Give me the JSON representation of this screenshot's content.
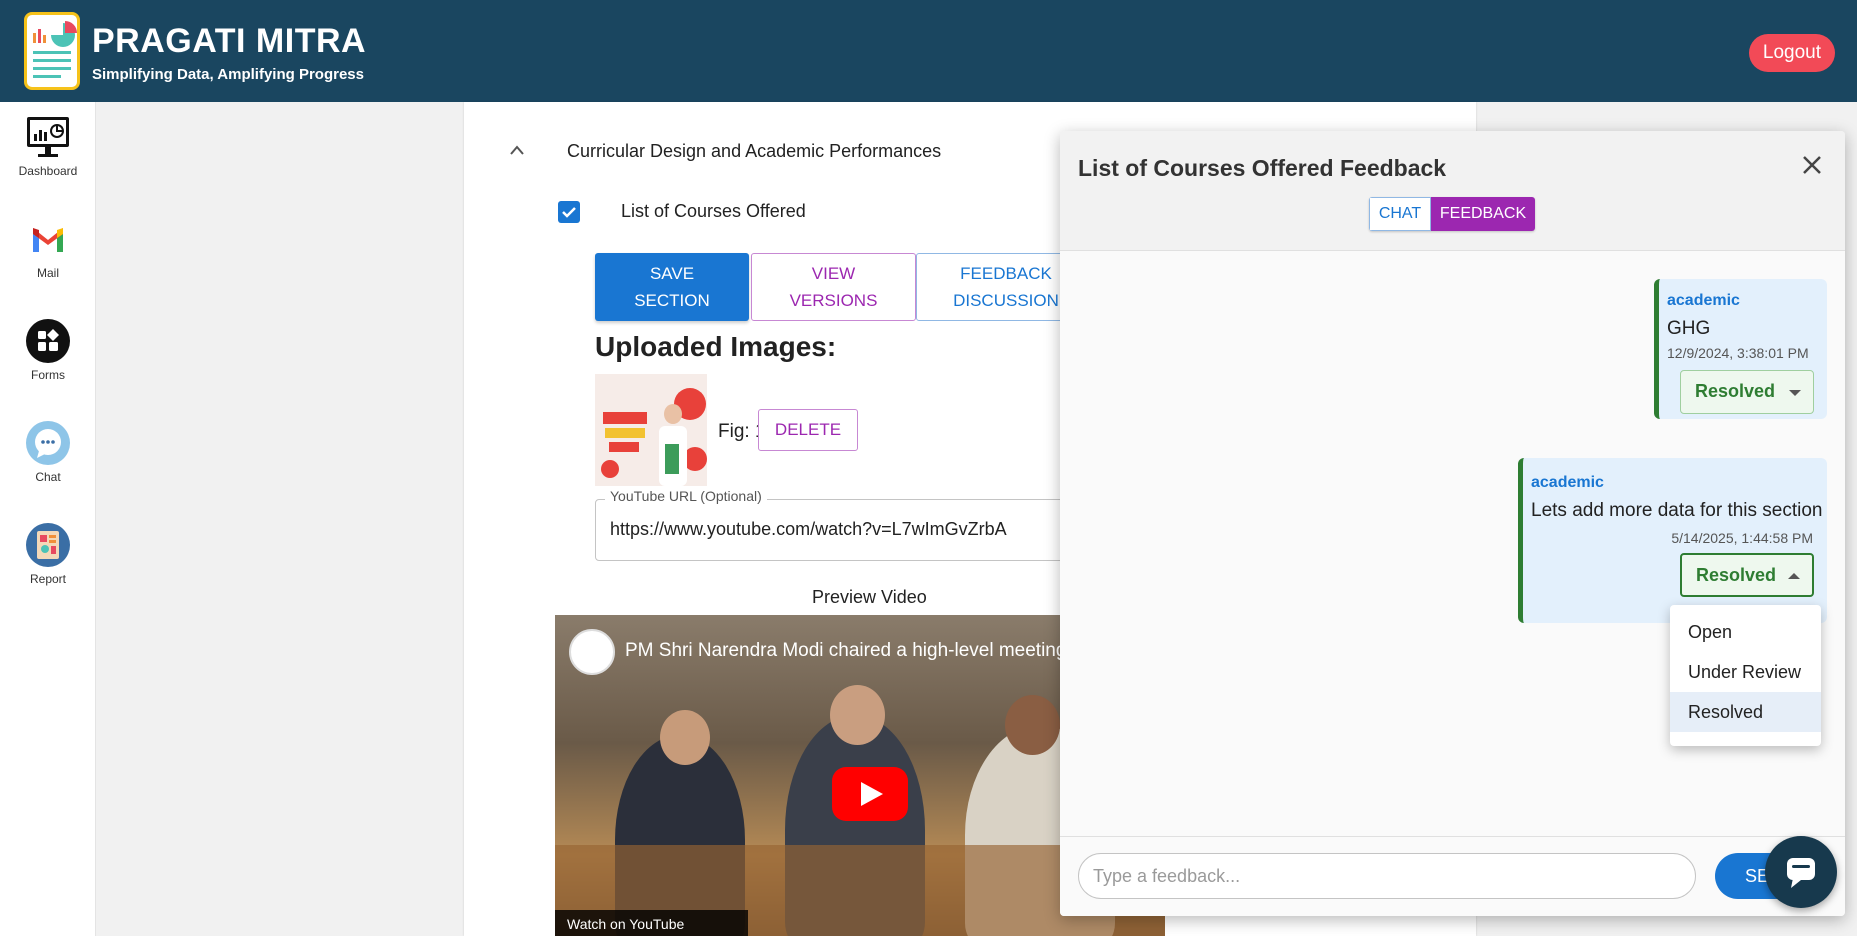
{
  "app": {
    "title": "PRAGATI MITRA",
    "subtitle": "Simplifying Data, Amplifying Progress",
    "logout_label": "Logout"
  },
  "sidebar": {
    "items": [
      {
        "label": "Dashboard",
        "icon": "monitor-chart-icon"
      },
      {
        "label": "Mail",
        "icon": "gmail-icon"
      },
      {
        "label": "Forms",
        "icon": "forms-grid-icon"
      },
      {
        "label": "Chat",
        "icon": "chat-bubble-icon"
      },
      {
        "label": "Report",
        "icon": "report-icon"
      }
    ]
  },
  "main": {
    "section_title": "Curricular Design and Academic Performances",
    "subsection_title": "List of Courses Offered",
    "subsection_checked": true,
    "buttons": {
      "save_line1": "SAVE",
      "save_line2": "SECTION",
      "versions_line1": "VIEW",
      "versions_line2": "VERSIONS",
      "feedback_line1": "FEEDBACK",
      "feedback_line2": "DISCUSSION"
    },
    "uploaded_title": "Uploaded Images:",
    "figure_label": "Fig: 1",
    "delete_label": "DELETE",
    "youtube": {
      "label": "YouTube URL (Optional)",
      "value": "https://www.youtube.com/watch?v=L7wImGvZrbA"
    },
    "preview_label": "Preview Video",
    "video": {
      "title": "PM Shri Narendra Modi chaired a high-level meeting",
      "watch_label": "Watch on YouTube"
    }
  },
  "feedback_panel": {
    "title": "List of Courses Offered Feedback",
    "tabs": [
      {
        "label": "CHAT",
        "active": false
      },
      {
        "label": "FEEDBACK",
        "active": true
      }
    ],
    "messages": [
      {
        "author": "academic",
        "text": "GHG",
        "timestamp": "12/9/2024, 3:38:01 PM",
        "status": "Resolved"
      },
      {
        "author": "academic",
        "text": "Lets add more data for this section",
        "timestamp": "5/14/2025, 1:44:58 PM",
        "status": "Resolved"
      }
    ],
    "status_options": [
      "Open",
      "Under Review",
      "Resolved"
    ],
    "selected_status": "Resolved",
    "input_placeholder": "Type a feedback...",
    "send_label": "SEND"
  },
  "colors": {
    "header_bg": "#1a4660",
    "primary": "#1976d2",
    "secondary": "#9c27b0",
    "resolved": "#2e7d32",
    "logout": "#f24a57"
  }
}
